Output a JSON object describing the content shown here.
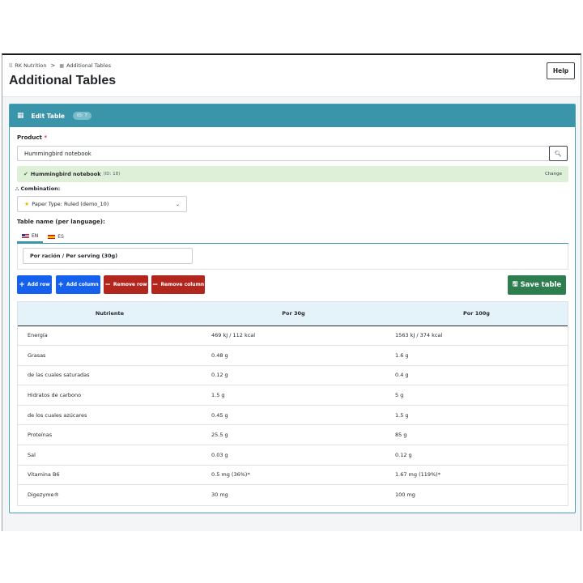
{
  "breadcrumb": {
    "root": "RK Nutrition",
    "separator": ">",
    "current": "Additional Tables"
  },
  "page": {
    "title": "Additional Tables",
    "help_label": "Help"
  },
  "card": {
    "title": "Edit Table",
    "id_badge": "ID: 7"
  },
  "product": {
    "label": "Product",
    "required_mark": "*",
    "value": "Hummingbird notebook",
    "selected_name": "Hummingbird notebook",
    "selected_meta": "(ID: 18)",
    "change_label": "Change"
  },
  "combination": {
    "label": "Combination:",
    "value": "Paper Type: Ruled (demo_10)"
  },
  "table_name": {
    "label": "Table name (per language):",
    "tabs": [
      {
        "label": "EN",
        "flag": "us-flag"
      },
      {
        "label": "ES",
        "flag": "es-flag"
      }
    ],
    "value_en": "Por ración / Per serving (30g)"
  },
  "actions": {
    "add_row": "Add row",
    "add_column": "Add column",
    "remove_row": "Remove row",
    "remove_column": "Remove column",
    "save": "Save table"
  },
  "colors": {
    "header_teal": "#3a95ab",
    "add_blue": "#1561ee",
    "remove_red": "#b3261e",
    "save_green": "#2e7d4f",
    "alert_green": "#dff0d8"
  },
  "nutrition_table": {
    "headers": [
      "Nutriente",
      "Por 30g",
      "Por 100g"
    ],
    "rows": [
      [
        "Energía",
        "469 kJ / 112 kcal",
        "1563 kJ / 374 kcal"
      ],
      [
        "Grasas",
        "0.48 g",
        "1.6 g"
      ],
      [
        "de las cuales saturadas",
        "0.12 g",
        "0.4 g"
      ],
      [
        "Hidratos de carbono",
        "1.5 g",
        "5 g"
      ],
      [
        "de los cuales azúcares",
        "0.45 g",
        "1.5 g"
      ],
      [
        "Proteínas",
        "25.5 g",
        "85 g"
      ],
      [
        "Sal",
        "0.03 g",
        "0.12 g"
      ],
      [
        "Vitamina B6",
        "0.5 mg (36%)*",
        "1.67 mg (119%)*"
      ],
      [
        "Digezyme®",
        "30 mg",
        "100 mg"
      ]
    ]
  }
}
